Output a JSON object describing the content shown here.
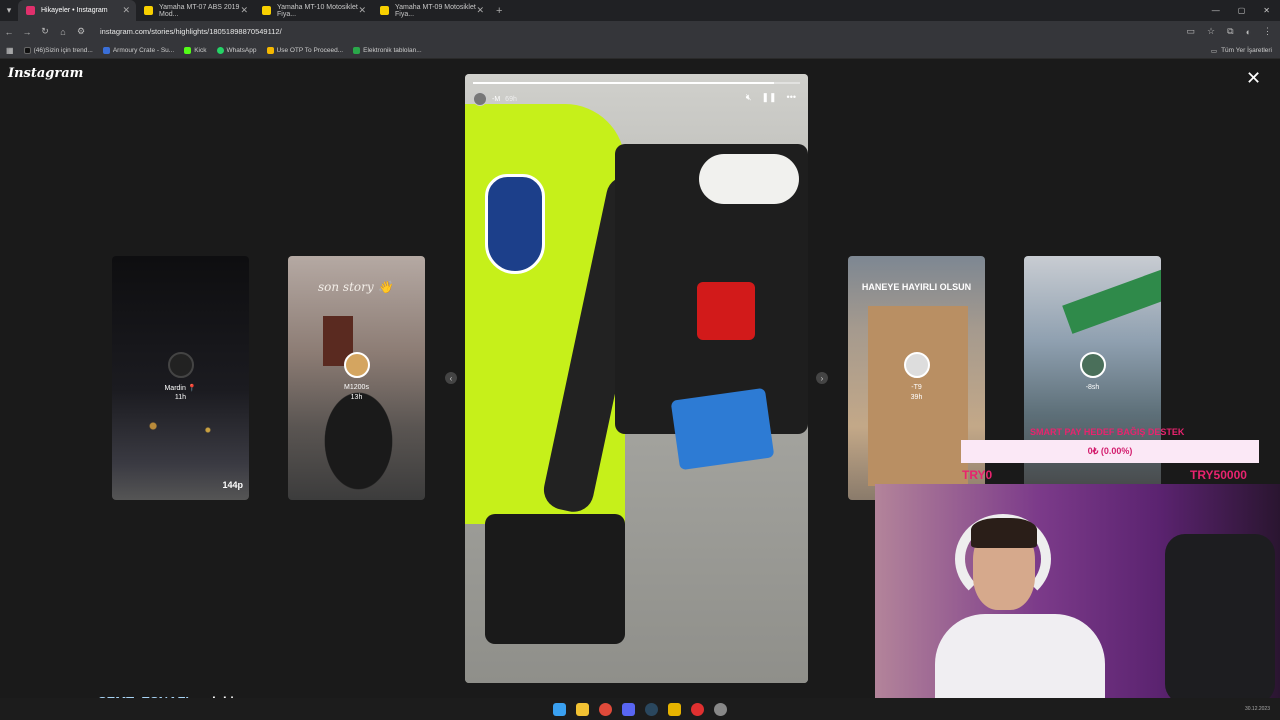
{
  "browser": {
    "tabs": [
      {
        "label": "Hikayeler • Instagram",
        "active": true,
        "favicon": "instagram-icon",
        "color": "#e1306c"
      },
      {
        "label": "Yamaha MT-07 ABS 2019 Mod...",
        "active": false,
        "favicon": "sahibinden-icon",
        "color": "#f8d000"
      },
      {
        "label": "Yamaha MT-10 Motosiklet Fiya...",
        "active": false,
        "favicon": "sahibinden-icon",
        "color": "#f8d000"
      },
      {
        "label": "Yamaha MT-09 Motosiklet Fiya...",
        "active": false,
        "favicon": "sahibinden-icon",
        "color": "#f8d000"
      }
    ],
    "url": "instagram.com/stories/highlights/18051898870549112/",
    "bookmarks": [
      {
        "label": "(46)Sizin için trend...",
        "color": "#111"
      },
      {
        "label": "Armoury Crate - Su...",
        "color": "#3a6fd8"
      },
      {
        "label": "Kick",
        "color": "#53fc18"
      },
      {
        "label": "WhatsApp",
        "color": "#25d366"
      },
      {
        "label": "Use OTP To Proceed...",
        "color": "#f5b800"
      },
      {
        "label": "Elektronik tablolan...",
        "color": "#2aa84a"
      }
    ],
    "all_bookmarks": "Tüm Yer İşaretleri"
  },
  "instagram": {
    "logo": "Instagram",
    "main_story": {
      "user": "-M",
      "time": "69h",
      "progress": 0.92
    },
    "side_stories": [
      {
        "name": "Mardin 📍",
        "time": "11h",
        "extra": "144p"
      },
      {
        "name": "M1200s",
        "time": "13h",
        "text": "son story 👋"
      },
      {
        "name": "-T9",
        "time": "39h",
        "text": "HANEYE HAYIRLI OLSUN"
      },
      {
        "name": "-8sh",
        "time": ""
      }
    ]
  },
  "overlay": {
    "title": "SMART PAY HEDEF BAĞIŞ DESTEK",
    "amount": "0₺ (0.00%)",
    "left": "TRY0",
    "right": "TRY50000"
  },
  "chat": {
    "name": "SEMT_ESNAFI",
    "message": "yok ki aw"
  },
  "clock": "30.12.2023"
}
